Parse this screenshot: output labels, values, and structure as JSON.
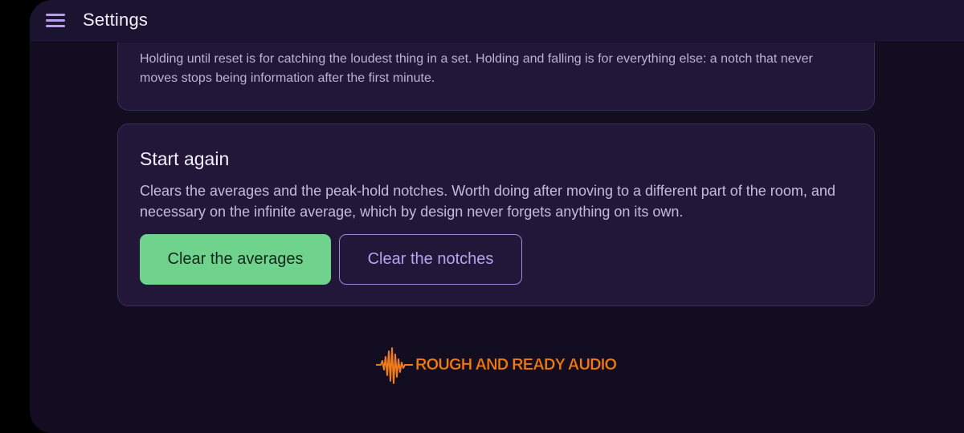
{
  "app_bar": {
    "title": "Settings",
    "menu_icon": "hamburger-menu-icon"
  },
  "peak_hold_card": {
    "description": "Holding until reset is for catching the loudest thing in a set. Holding and falling is for everything else: a notch that never moves stops being information after the first minute."
  },
  "start_again_card": {
    "heading": "Start again",
    "description": "Clears the averages and the peak-hold notches. Worth doing after moving to a different part of the room, and necessary on the infinite average, which by design never forgets anything on its own.",
    "clear_averages_label": "Clear the averages",
    "clear_notches_label": "Clear the notches"
  },
  "footer": {
    "logo_text": "ROUGH AND READY AUDIO",
    "logo_icon": "sound-wave-icon"
  },
  "colors": {
    "background": "#130d22",
    "card": "#221738",
    "accent_green": "#6fd38d",
    "accent_purple": "#b8a4ee",
    "logo_orange": "#f07c1c"
  }
}
